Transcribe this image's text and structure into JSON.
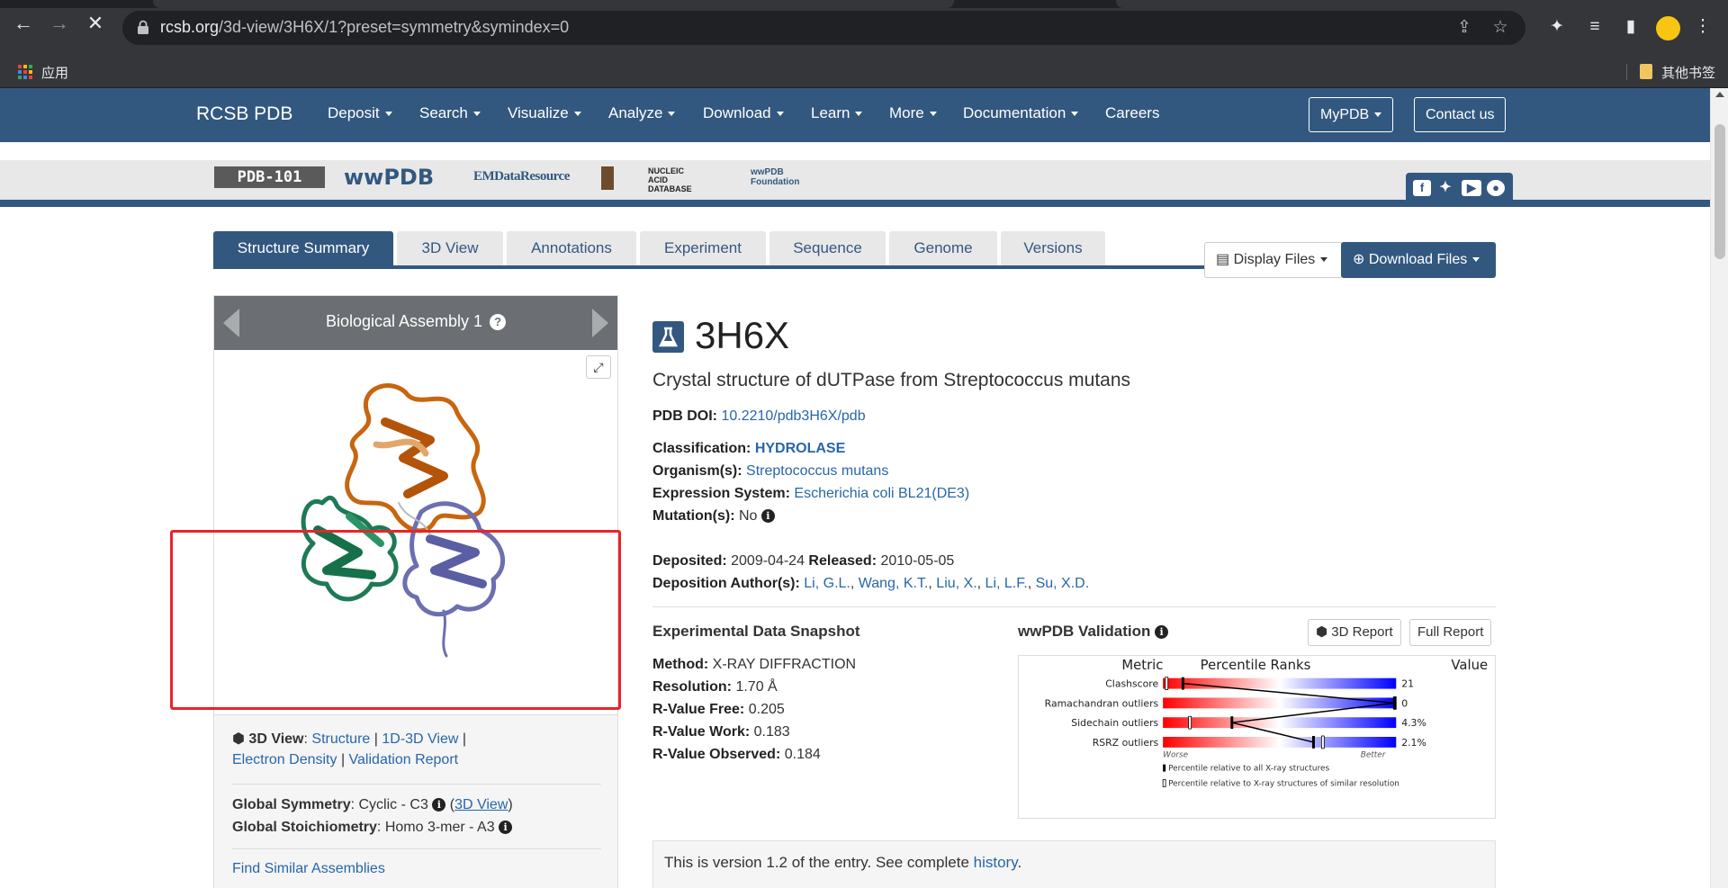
{
  "browser": {
    "url_host": "rcsb.org",
    "url_path": "/3d-view/3H6X/1?preset=symmetry&symindex=0",
    "bookmarks_apps": "应用",
    "bookmarks_other": "其他书签"
  },
  "site_nav": {
    "brand": "RCSB PDB",
    "items": [
      "Deposit",
      "Search",
      "Visualize",
      "Analyze",
      "Download",
      "Learn",
      "More",
      "Documentation",
      "Careers"
    ],
    "mypdb": "MyPDB",
    "contact": "Contact us"
  },
  "partners": [
    "PDB-101",
    "wwPDB",
    "EMDataResource",
    "NUCLEIC ACID DATABASE",
    "wwPDB Foundation"
  ],
  "tabs": [
    "Structure Summary",
    "3D View",
    "Annotations",
    "Experiment",
    "Sequence",
    "Genome",
    "Versions"
  ],
  "assembly": {
    "title": "Biological Assembly 1",
    "help": "?",
    "view_label": "3D View",
    "links_1": [
      "Structure",
      "1D-3D View"
    ],
    "links_2": [
      "Electron Density",
      "Validation Report"
    ],
    "symmetry_label": "Global Symmetry",
    "symmetry_value": "Cyclic - C3",
    "symmetry_link": "3D View",
    "stoich_label": "Global Stoichiometry",
    "stoich_value": "Homo 3-mer - A3",
    "find_similar": "Find Similar Assemblies"
  },
  "entry": {
    "display_files": "Display Files",
    "download_files": "Download Files",
    "id": "3H6X",
    "title": "Crystal structure of dUTPase from Streptococcus mutans",
    "doi_label": "PDB DOI:",
    "doi": "10.2210/pdb3H6X/pdb",
    "classification_label": "Classification:",
    "classification": "HYDROLASE",
    "organism_label": "Organism(s):",
    "organism": "Streptococcus mutans",
    "expression_label": "Expression System:",
    "expression": "Escherichia coli BL21(DE3)",
    "mutation_label": "Mutation(s):",
    "mutation": "No",
    "deposited_label": "Deposited:",
    "deposited": "2009-04-24",
    "released_label": "Released:",
    "released": "2010-05-05",
    "authors_label": "Deposition Author(s):",
    "authors": [
      "Li, G.L.",
      "Wang, K.T.",
      "Liu, X.",
      "Li, L.F.",
      "Su, X.D."
    ]
  },
  "experimental": {
    "title": "Experimental Data Snapshot",
    "method_label": "Method:",
    "method": "X-RAY DIFFRACTION",
    "resolution_label": "Resolution:",
    "resolution": "1.70 Å",
    "rfree_label": "R-Value Free:",
    "rfree": "0.205",
    "rwork_label": "R-Value Work:",
    "rwork": "0.183",
    "robs_label": "R-Value Observed:",
    "robs": "0.184"
  },
  "validation": {
    "title": "wwPDB Validation",
    "report_3d": "3D Report",
    "full_report": "Full Report",
    "col_metric": "Metric",
    "col_rank": "Percentile Ranks",
    "col_value": "Value",
    "worse": "Worse",
    "better": "Better",
    "legend_all": "Percentile relative to all X-ray structures",
    "legend_similar": "Percentile relative to X-ray structures of similar resolution",
    "metrics": [
      {
        "name": "Clashscore",
        "value": "21",
        "all_pct": 8,
        "similar_pct": 1
      },
      {
        "name": "Ramachandran outliers",
        "value": "0",
        "all_pct": 100,
        "similar_pct": 100
      },
      {
        "name": "Sidechain outliers",
        "value": "4.3%",
        "all_pct": 29,
        "similar_pct": 11
      },
      {
        "name": "RSRZ outliers",
        "value": "2.1%",
        "all_pct": 64,
        "similar_pct": 68
      }
    ]
  },
  "version": {
    "text": "This is version 1.2 of the entry. See complete",
    "link": "history",
    "end": "."
  }
}
